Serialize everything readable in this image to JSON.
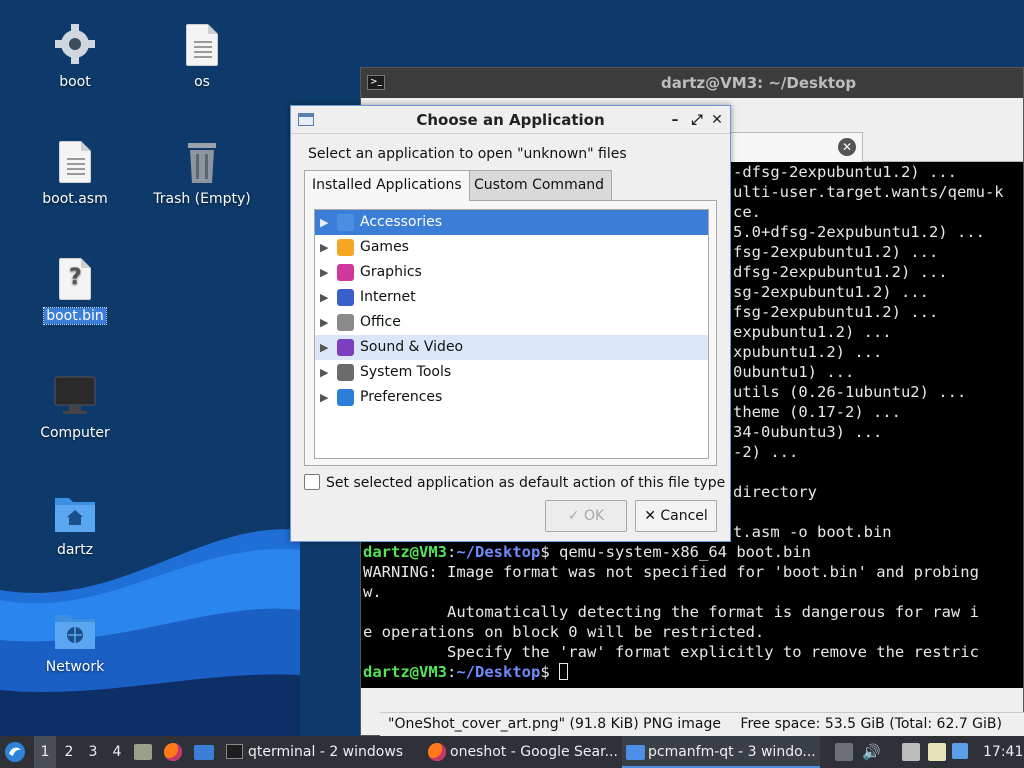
{
  "desktop": {
    "icons": [
      {
        "label": "boot",
        "icon": "gear-folder-icon"
      },
      {
        "label": "os",
        "icon": "text-file-icon"
      },
      {
        "label": "boot.asm",
        "icon": "text-file-icon"
      },
      {
        "label": "Trash (Empty)",
        "icon": "trash-icon"
      },
      {
        "label": "boot.bin",
        "icon": "unknown-file-icon",
        "selected": true
      },
      {
        "label": "Computer",
        "icon": "computer-icon"
      },
      {
        "label": "dartz",
        "icon": "home-folder-icon"
      },
      {
        "label": "Network",
        "icon": "network-folder-icon"
      }
    ]
  },
  "terminal": {
    "title": "dartz@VM3: ~/Desktop",
    "lines": [
      "-dfsg-2expubuntu1.2) ...",
      "ulti-user.target.wants/qemu-k",
      "ce.",
      "5.0+dfsg-2expubuntu1.2) ...",
      "fsg-2expubuntu1.2) ...",
      "dfsg-2expubuntu1.2) ...",
      "sg-2expubuntu1.2) ...",
      "fsg-2expubuntu1.2) ...",
      "expubuntu1.2) ...",
      "xpubuntu1.2) ...",
      "0ubuntu1) ...",
      "utils (0.26-1ubuntu2) ...",
      "theme (0.17-2) ...",
      "34-0ubuntu3) ...",
      "-2) ...",
      "",
      "directory",
      "",
      "t.asm -o boot.bin"
    ],
    "prompt_user": "dartz@VM3",
    "prompt_path": "~/Desktop",
    "command": " qemu-system-x86_64 boot.bin",
    "output": [
      "WARNING: Image format was not specified for 'boot.bin' and probing",
      "w.",
      "         Automatically detecting the format is dangerous for raw i",
      "e operations on block 0 will be restricted.",
      "         Specify the 'raw' format explicitly to remove the restric"
    ]
  },
  "file_manager_status": {
    "selection": "\"OneShot_cover_art.png\" (91.8 KiB) PNG image",
    "free_space": "Free space: 53.5 GiB (Total: 62.7 GiB)"
  },
  "dialog": {
    "title": "Choose an Application",
    "message": "Select an application to open \"unknown\" files",
    "tabs": [
      "Installed Applications",
      "Custom Command"
    ],
    "categories": [
      {
        "label": "Accessories",
        "color": "#4a90e2",
        "state": "selected"
      },
      {
        "label": "Games",
        "color": "#f5a623",
        "state": ""
      },
      {
        "label": "Graphics",
        "color": "#d0389b",
        "state": ""
      },
      {
        "label": "Internet",
        "color": "#3a5fcd",
        "state": ""
      },
      {
        "label": "Office",
        "color": "#8a8a8a",
        "state": ""
      },
      {
        "label": "Sound & Video",
        "color": "#7b3fbf",
        "state": "hover"
      },
      {
        "label": "System Tools",
        "color": "#6b6b6b",
        "state": ""
      },
      {
        "label": "Preferences",
        "color": "#2b7fd8",
        "state": ""
      }
    ],
    "default_checkbox_label": "Set selected application as default action of this file type",
    "ok_label": "OK",
    "cancel_label": "Cancel"
  },
  "taskbar": {
    "workspaces": [
      "1",
      "2",
      "3",
      "4"
    ],
    "tasks": [
      {
        "label": "qterminal - 2 windows",
        "icon": "terminal-icon"
      },
      {
        "label": "oneshot - Google Sear...",
        "icon": "firefox-icon"
      },
      {
        "label": "pcmanfm-qt - 3 windo...",
        "icon": "folder-icon"
      }
    ],
    "clock": "17:41"
  }
}
